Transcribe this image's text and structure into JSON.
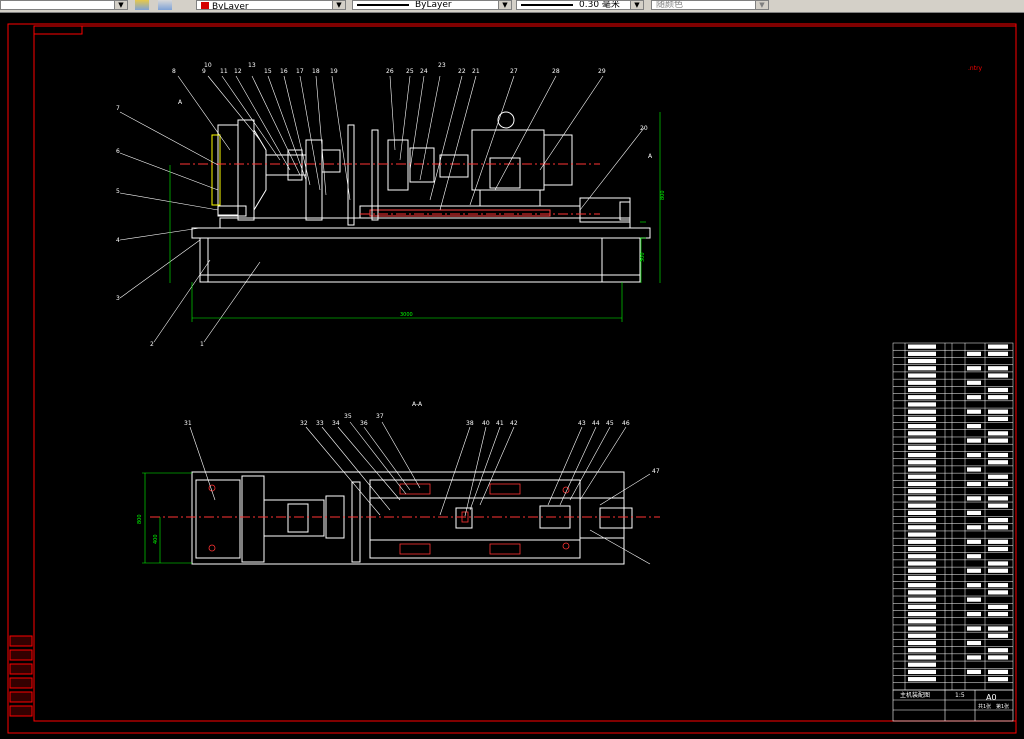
{
  "toolbar": {
    "layer_color_value": "ByLayer",
    "linetype_value": "ByLayer",
    "lineweight_value": "0.30 毫米",
    "plotstyle_value": "随颜色"
  },
  "drawing": {
    "section_label": "A-A",
    "view_mark_left": "A",
    "view_mark_right": "A",
    "dims": {
      "overall_length": "3000",
      "height_top": "800",
      "base_height": "300",
      "width_plan": "800",
      "half_width_plan": "400"
    },
    "top_balloons": [
      "8",
      "9",
      "10",
      "11",
      "12",
      "13",
      "15",
      "16",
      "17",
      "18",
      "19",
      "26",
      "25",
      "24",
      "23",
      "22",
      "21",
      "27",
      "28",
      "29"
    ],
    "plan_balloons": [
      "31",
      "32",
      "33",
      "34",
      "35",
      "36",
      "37",
      "38",
      "40",
      "41",
      "42",
      "43",
      "44",
      "45",
      "46",
      "47"
    ],
    "left_balloons": [
      "7",
      "6",
      "5",
      "4",
      "3",
      "2",
      "1"
    ],
    "right_balloon": "20"
  },
  "title_block": {
    "scale": "1:5",
    "sheet": "A0",
    "name": "主机装配图",
    "sheet_no": "共1张",
    "page": "第1张"
  },
  "colors": {
    "frame": "#ff0000",
    "lines": "#ffffff",
    "dims": "#00ff00",
    "center": "#ff3333",
    "bg": "#000000"
  }
}
